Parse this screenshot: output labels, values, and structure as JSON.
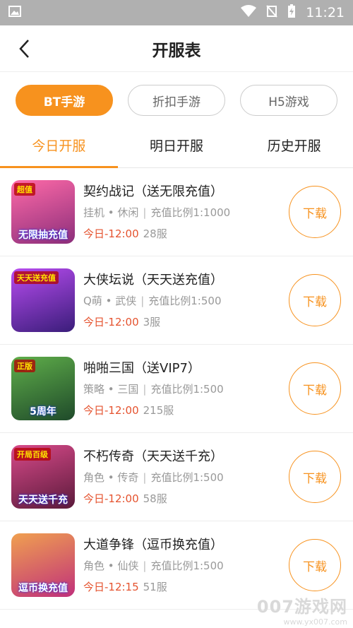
{
  "status_bar": {
    "time": "11:21"
  },
  "header": {
    "title": "开服表",
    "back_icon": "chevron-left-icon"
  },
  "filters": [
    {
      "label": "BT手游",
      "active": true
    },
    {
      "label": "折扣手游",
      "active": false
    },
    {
      "label": "H5游戏",
      "active": false
    }
  ],
  "tabs": [
    {
      "label": "今日开服",
      "active": true
    },
    {
      "label": "明日开服",
      "active": false
    },
    {
      "label": "历史开服",
      "active": false
    }
  ],
  "games": [
    {
      "name": "契约战记（送无限充值）",
      "genre": "挂机 • 休闲",
      "ratio": "充值比例1:1000",
      "time": "今日-12:00",
      "server": "28服",
      "icon_text": "无限抽充值",
      "icon_tag": "超值",
      "button": "下载",
      "colors": [
        "#ff6aa8",
        "#8b2e7a"
      ]
    },
    {
      "name": "大侠坛说（天天送充值）",
      "genre": "Q萌 • 武侠",
      "ratio": "充值比例1:500",
      "time": "今日-12:00",
      "server": "3服",
      "icon_text": "",
      "icon_tag": "天天送充值",
      "button": "下载",
      "colors": [
        "#b84cf0",
        "#3a1d7a"
      ]
    },
    {
      "name": "啪啪三国（送VIP7）",
      "genre": "策略 • 三国",
      "ratio": "充值比例1:500",
      "time": "今日-12:00",
      "server": "215服",
      "icon_text": "5周年",
      "icon_tag": "正版",
      "button": "下载",
      "colors": [
        "#5fae4a",
        "#1f4a2a"
      ]
    },
    {
      "name": "不朽传奇（天天送千充）",
      "genre": "角色 • 传奇",
      "ratio": "充值比例1:500",
      "time": "今日-12:00",
      "server": "58服",
      "icon_text": "天天送千充",
      "icon_tag": "开局百级",
      "button": "下载",
      "colors": [
        "#d84a8a",
        "#5a1a3a"
      ]
    },
    {
      "name": "大道争锋（逗币换充值）",
      "genre": "角色 • 仙侠",
      "ratio": "充值比例1:500",
      "time": "今日-12:15",
      "server": "51服",
      "icon_text": "逗币换充值",
      "icon_tag": "",
      "button": "下载",
      "colors": [
        "#f0a050",
        "#c0307a"
      ]
    }
  ],
  "watermark": {
    "big": "007游戏网",
    "small": "www.yx007.com"
  }
}
